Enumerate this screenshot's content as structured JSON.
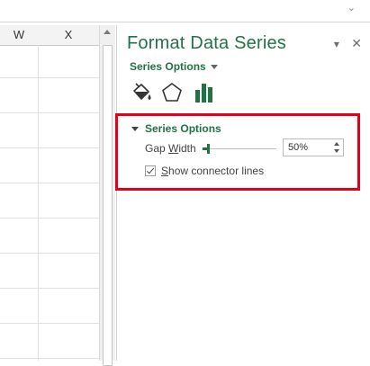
{
  "sheet": {
    "columns": [
      "W",
      "X"
    ]
  },
  "pane": {
    "title": "Format Data Series",
    "controls": {
      "options_caret": "▾",
      "close": "✕"
    },
    "series_dropdown": "Series Options",
    "tab_icons": [
      "fill-line-icon",
      "effects-pentagon-icon",
      "series-options-bar-icon"
    ],
    "section": {
      "title": "Series Options",
      "gap_width": {
        "label_pre": "Gap ",
        "label_accel": "W",
        "label_post": "idth",
        "value": "50%",
        "level_percent": 6
      },
      "connector": {
        "label_accel": "S",
        "label_post": "how connector lines",
        "checked": true
      }
    }
  },
  "colors": {
    "accent": "#217346",
    "highlight": "#e3001b"
  }
}
